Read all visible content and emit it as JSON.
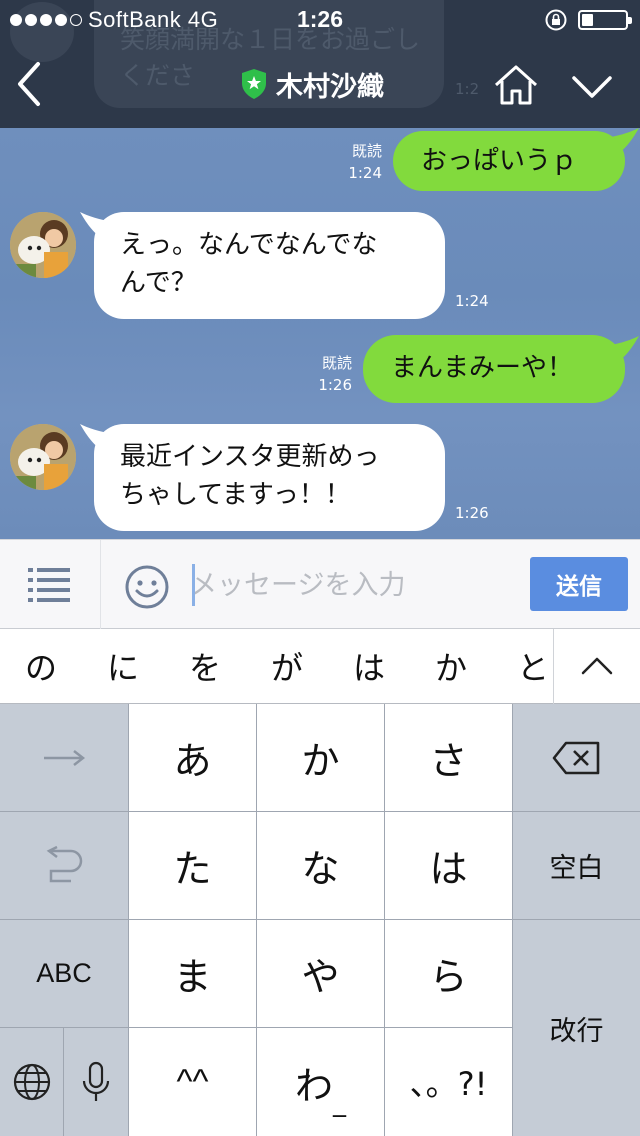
{
  "status_bar": {
    "carrier": "SoftBank  4G",
    "time": "1:26",
    "battery_level": 0.25
  },
  "background_message": {
    "text": "笑顔満開な１日をお過ごしくださ",
    "time": "1:2"
  },
  "header": {
    "title": "木村沙織",
    "back_icon": "chevron-left-icon",
    "badge_icon": "official-shield-icon",
    "home_icon": "home-icon",
    "dropdown_icon": "chevron-down-icon"
  },
  "messages": [
    {
      "direction": "out",
      "text": "おっぱいうｐ",
      "read": "既読",
      "time": "1:24"
    },
    {
      "direction": "in",
      "text_lines": [
        "えっ。なんでなんでな",
        "んで？"
      ],
      "time": "1:24"
    },
    {
      "direction": "out",
      "text": "まんまみーや！",
      "read": "既読",
      "time": "1:26"
    },
    {
      "direction": "in",
      "text_lines": [
        "最近インスタ更新めっ",
        "ちゃしてますっ！！"
      ],
      "time": "1:26"
    }
  ],
  "input": {
    "placeholder": "メッセージを入力",
    "send_label": "送信"
  },
  "suggestions": [
    "の",
    "に",
    "を",
    "が",
    "は",
    "か",
    "と"
  ],
  "keyboard": {
    "row1": [
      "あ",
      "か",
      "さ"
    ],
    "row2": [
      "た",
      "な",
      "は"
    ],
    "row3": [
      "ま",
      "や",
      "ら"
    ],
    "row4": [
      "^^",
      "わ",
      "、。?!"
    ],
    "space_label": "空白",
    "abc_label": "ABC",
    "return_label": "改行",
    "small_kana_mark": "_"
  },
  "colors": {
    "header_bg": "#2d3849",
    "chat_bg": "#6f8fbd",
    "outgoing_bubble": "#82da3d",
    "incoming_bubble": "#ffffff",
    "send_button": "#5a8de0"
  }
}
